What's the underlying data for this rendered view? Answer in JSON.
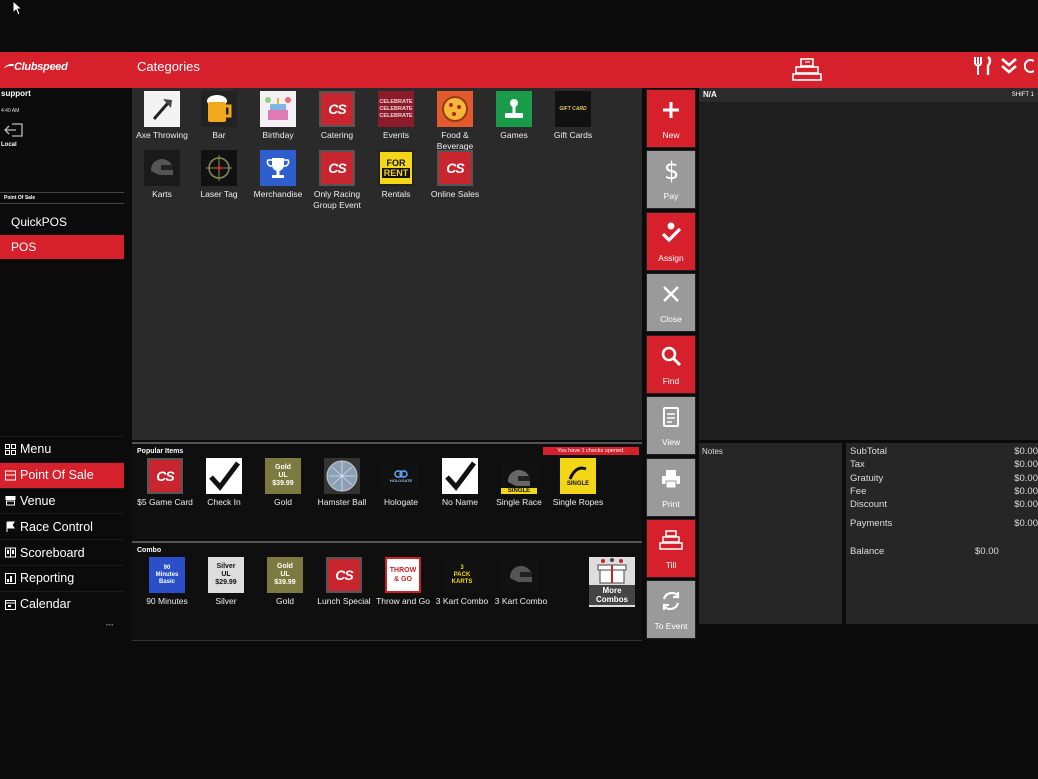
{
  "brand": "Clubspeed",
  "header": {
    "title": "Categories"
  },
  "user": {
    "name": "support",
    "time": "4:40 AM",
    "location": "Local"
  },
  "sidebar": {
    "section": "Point Of Sale",
    "items": [
      {
        "label": "QuickPOS"
      },
      {
        "label": "POS"
      }
    ],
    "nav": [
      {
        "label": "Menu",
        "icon": "grid-icon"
      },
      {
        "label": "Point Of Sale",
        "icon": "register-icon"
      },
      {
        "label": "Venue",
        "icon": "venue-icon"
      },
      {
        "label": "Race Control",
        "icon": "flag-icon"
      },
      {
        "label": "Scoreboard",
        "icon": "scoreboard-icon"
      },
      {
        "label": "Reporting",
        "icon": "chart-icon"
      },
      {
        "label": "Calendar",
        "icon": "calendar-icon"
      }
    ]
  },
  "categories": [
    {
      "label": "Axe Throwing"
    },
    {
      "label": "Bar"
    },
    {
      "label": "Birthday"
    },
    {
      "label": "Catering"
    },
    {
      "label": "Events"
    },
    {
      "label": "Food & Beverage"
    },
    {
      "label": "Games"
    },
    {
      "label": "Gift Cards"
    },
    {
      "label": "Karts"
    },
    {
      "label": "Laser Tag"
    },
    {
      "label": "Merchandise"
    },
    {
      "label": "Only Racing Group Event"
    },
    {
      "label": "Rentals"
    },
    {
      "label": "Online Sales"
    }
  ],
  "tile_text": {
    "cs": "CS",
    "celebrate": "CELEBRATE",
    "giftcard": "GIFT CARD",
    "for": "FOR",
    "rent": "RENT",
    "single": "SINGLE",
    "hologate": "HOLOGATE",
    "gold_ul": [
      "Gold",
      "UL",
      "$39.99"
    ],
    "silver_ul": [
      "Silver",
      "UL",
      "$29.99"
    ],
    "minutes": [
      "90",
      "Minutes",
      "Basic"
    ],
    "throw_go": [
      "THROW",
      "& GO"
    ],
    "three_pack": [
      "3",
      "PACK",
      "KARTS"
    ]
  },
  "popular": {
    "title": "Popular Items",
    "badge": "You have 1 checks opened.",
    "items": [
      {
        "label": "$5 Game Card"
      },
      {
        "label": "Check In"
      },
      {
        "label": "Gold"
      },
      {
        "label": "Hamster Ball"
      },
      {
        "label": "Hologate"
      },
      {
        "label": "No Name"
      },
      {
        "label": "Single Race"
      },
      {
        "label": "Single Ropes"
      }
    ]
  },
  "combo": {
    "title": "Combo",
    "items": [
      {
        "label": "90 Minutes"
      },
      {
        "label": "Silver"
      },
      {
        "label": "Gold"
      },
      {
        "label": "Lunch Special"
      },
      {
        "label": "Throw and Go"
      },
      {
        "label": "3 Kart Combo"
      },
      {
        "label": "3 Kart Combo"
      }
    ],
    "more": "More Combos"
  },
  "actions": [
    {
      "label": "New"
    },
    {
      "label": "Pay"
    },
    {
      "label": "Assign"
    },
    {
      "label": "Close"
    },
    {
      "label": "Find"
    },
    {
      "label": "View"
    },
    {
      "label": "Print"
    },
    {
      "label": "Till"
    },
    {
      "label": "To Event"
    }
  ],
  "order": {
    "customer": "N/A",
    "shift": "SHIFT 1"
  },
  "notes": {
    "label": "Notes"
  },
  "totals": {
    "rows": [
      {
        "label": "SubTotal",
        "value": "$0.00"
      },
      {
        "label": "Tax",
        "value": "$0.00"
      },
      {
        "label": "Gratuity",
        "value": "$0.00"
      },
      {
        "label": "Fee",
        "value": "$0.00"
      },
      {
        "label": "Discount",
        "value": "$0.00"
      },
      {
        "label": "Payments",
        "value": "$0.00"
      }
    ],
    "balance_label": "Balance",
    "balance_value": "$0.00"
  },
  "colors": {
    "brand_red": "#d6202c",
    "panel": "#2a2a2a",
    "grey_button": "#9a9a9a"
  }
}
